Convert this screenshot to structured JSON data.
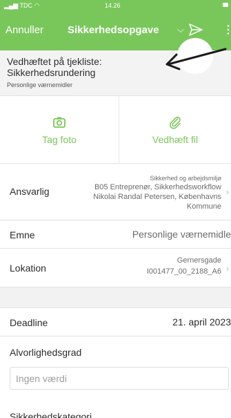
{
  "status_bar": {
    "carrier": "TDC",
    "time": "14.26"
  },
  "nav": {
    "cancel": "Annuller",
    "title": "Sikkerhedsopgave",
    "title_chevron": "⌵",
    "more": "⋮"
  },
  "attached": {
    "line1": "Vedhæftet på tjekliste:",
    "line2": "Sikkerhedsrundering",
    "line3": "Personlige værnemidler"
  },
  "actions": {
    "photo": "Tag foto",
    "attach": "Vedhæft fil"
  },
  "fields": {
    "responsible": {
      "label": "Ansvarlig",
      "value_line1": "Sikkerhed og arbejdsmiljø",
      "value_line2": "B05 Entreprenør, Sikkerhedsworkflow",
      "value_line3": "Nikolai Randal Petersen, Københavns",
      "value_line4": "Kommune"
    },
    "subject": {
      "label": "Emne",
      "value": "Personlige værnemidle"
    },
    "location": {
      "label": "Lokation",
      "value_line1": "Gernersgade",
      "value_line2": "I001477_00_2188_A6"
    },
    "deadline": {
      "label": "Deadline",
      "value": "21. april 2023"
    },
    "severity": {
      "label": "Alvorlighedsgrad",
      "placeholder": "Ingen værdi"
    },
    "category": {
      "label": "Sikkerhedskategori"
    }
  },
  "chevron": "›",
  "colors": {
    "accent": "#79c75b",
    "text": "#2b2b2b",
    "muted": "#6b6b6b"
  }
}
